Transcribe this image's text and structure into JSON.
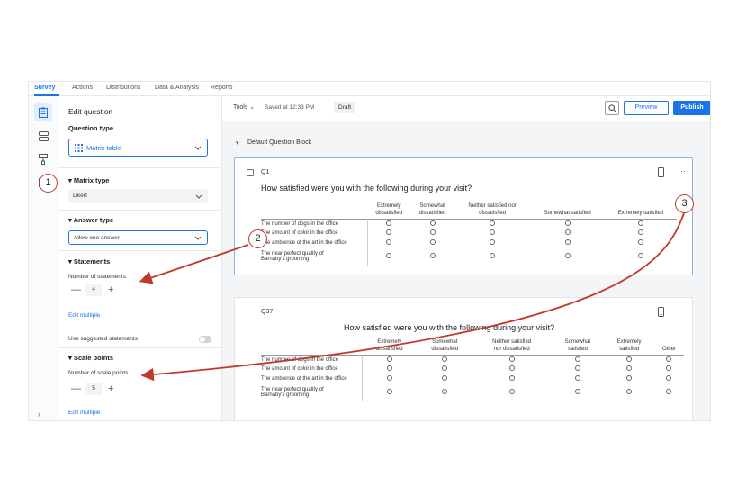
{
  "tabs": [
    "Survey",
    "Actions",
    "Distributions",
    "Data & Analysis",
    "Reports"
  ],
  "panel": {
    "title": "Edit question",
    "question_type_label": "Question type",
    "question_type_value": "Matrix table",
    "matrix_type_label": "Matrix type",
    "matrix_type_value": "Likert",
    "answer_type_label": "Answer type",
    "answer_type_value": "Allow one answer",
    "statements_label": "Statements",
    "num_statements_label": "Number of statements",
    "num_statements_value": "4",
    "edit_multiple_1": "Edit multiple",
    "use_suggested": "Use suggested statements",
    "scale_points_label": "Scale points",
    "num_scale_label": "Number of scale points",
    "num_scale_value": "5",
    "edit_multiple_2": "Edit multiple"
  },
  "toolbar": {
    "tools": "Tools",
    "saved": "Saved at 12:33 PM",
    "draft": "Draft",
    "preview": "Preview",
    "publish": "Publish"
  },
  "block_title": "Default Question Block",
  "q1": {
    "id": "Q1",
    "text": "How satisfied were you with the following during your visit?",
    "columns": [
      [
        "Extremely",
        "dissatisfied"
      ],
      [
        "Somewhat",
        "dissatisfied"
      ],
      [
        "Neither satisfied nor",
        "dissatisfied"
      ],
      [
        "",
        "Somewhat satisfied"
      ],
      [
        "",
        "Extremely satisfied"
      ]
    ],
    "rows": [
      [
        "The number of dogs in the office"
      ],
      [
        "The amount of color in the office"
      ],
      [
        "The ambience of the art in the office"
      ],
      [
        "The near perfect quality of",
        "Barnaby's grooming"
      ]
    ]
  },
  "q37": {
    "id": "Q37",
    "text": "How satisfied were you with the following during your visit?",
    "columns": [
      [
        "Extremely",
        "dissatisfied"
      ],
      [
        "Somewhat",
        "dissatisfied"
      ],
      [
        "Neither satisfied",
        "nor dissatisfied"
      ],
      [
        "Somewhat",
        "satisfied"
      ],
      [
        "Extremely",
        "satisfied"
      ],
      [
        "",
        "Other"
      ]
    ],
    "rows": [
      [
        "The number of dogs in the office"
      ],
      [
        "The amount of color in the office"
      ],
      [
        "The ambience of the art in the office"
      ],
      [
        "The near perfect quality of",
        "Barnaby's grooming"
      ]
    ]
  },
  "annotations": [
    "1",
    "2",
    "3"
  ],
  "colors": {
    "accent": "#1a73e8",
    "annotation": "#c0392b"
  },
  "icons": [
    "survey-icon",
    "workflow-icon",
    "paint-icon",
    "options-icon",
    "search-icon",
    "mobile-icon",
    "more-icon"
  ]
}
